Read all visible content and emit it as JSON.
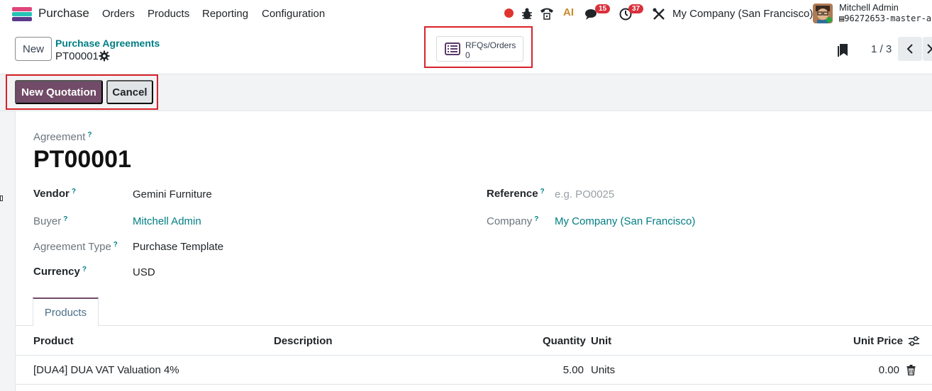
{
  "navbar": {
    "app_name": "Purchase",
    "menu": [
      "Orders",
      "Products",
      "Reporting",
      "Configuration"
    ],
    "messages_badge": "15",
    "activities_badge": "37",
    "ai_label": "AI",
    "company": "My Company (San Francisco)",
    "user_name": "Mitchell Admin",
    "db_name": "96272653-master-a"
  },
  "control": {
    "new_label": "New",
    "breadcrumb": "Purchase Agreements",
    "record": "PT00001",
    "smart_button": {
      "label": "RFQs/Orders",
      "count": "0"
    },
    "pager": "1 / 3"
  },
  "statusbar": {
    "primary": "New Quotation",
    "secondary": "Cancel"
  },
  "form": {
    "title_label": "Agreement",
    "title_value": "PT00001",
    "help": "?",
    "left": [
      {
        "label": "Vendor",
        "value": "Gemini Furniture",
        "required": true,
        "link": false
      },
      {
        "label": "Buyer",
        "value": "Mitchell Admin",
        "required": false,
        "link": true
      },
      {
        "label": "Agreement Type",
        "value": "Purchase Template",
        "required": false,
        "link": false
      },
      {
        "label": "Currency",
        "value": "USD",
        "required": true,
        "link": false
      }
    ],
    "right": [
      {
        "label": "Reference",
        "value": "",
        "placeholder": "e.g. PO0025",
        "required": true
      },
      {
        "label": "Company",
        "value": "My Company (San Francisco)",
        "required": false,
        "link": true
      }
    ]
  },
  "tabs": [
    "Products"
  ],
  "table": {
    "columns": [
      "Product",
      "Description",
      "Quantity",
      "Unit",
      "Unit Price"
    ],
    "rows": [
      {
        "product": "[DUA4] DUA VAT Valuation 4%",
        "description": "",
        "quantity": "5.00",
        "unit": "Units",
        "unit_price": "0.00"
      }
    ]
  },
  "colors": {
    "brand": "#714b67",
    "link": "#017e84",
    "highlight": "#d9222a",
    "badge": "#d9303b"
  }
}
